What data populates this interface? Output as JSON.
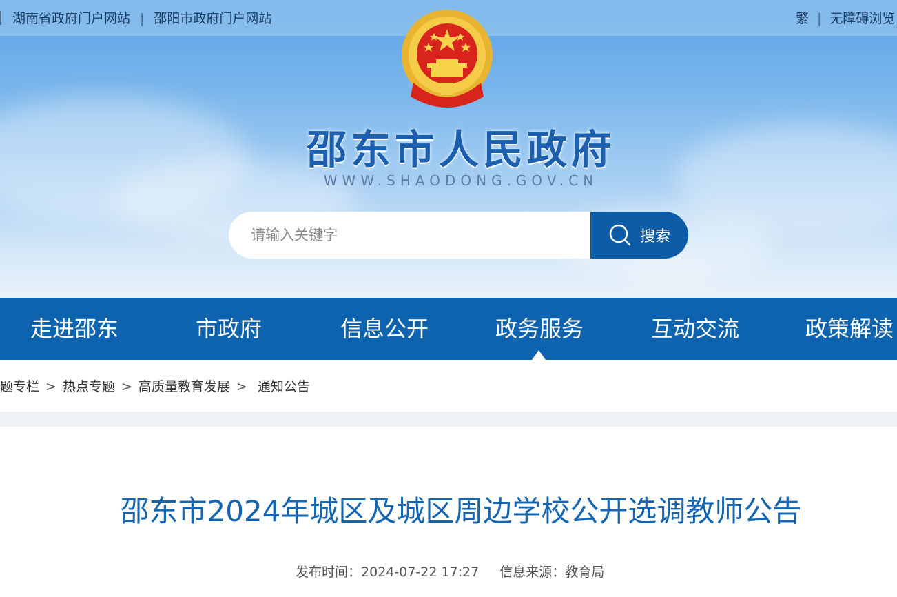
{
  "topbar": {
    "links_left": [
      "湖南省政府门户网站",
      "邵阳市政府门户网站"
    ],
    "traditional_label": "繁",
    "accessibility_label": "无障碍浏览"
  },
  "header": {
    "emblem_icon": "national-emblem-icon",
    "site_title": "邵东市人民政府",
    "site_url": "WWW.SHAODONG.GOV.CN"
  },
  "search": {
    "placeholder": "请输入关键字",
    "button_label": "搜索",
    "icon": "search-icon"
  },
  "nav": {
    "items": [
      "走进邵东",
      "市政府",
      "信息公开",
      "政务服务",
      "互动交流",
      "政策解读"
    ],
    "active": "政务服务"
  },
  "breadcrumb": {
    "items": [
      "题专栏",
      "热点专题",
      "高质量教育发展",
      "通知公告"
    ],
    "separator": ">"
  },
  "article": {
    "title": "邵东市2024年城区及城区周边学校公开选调教师公告",
    "published_label": "发布时间：",
    "published_value": "2024-07-22 17:27",
    "source_label": "信息来源：",
    "source_value": "教育局"
  },
  "colors": {
    "nav_bg": "#0d63ae",
    "title_blue": "#1565b0",
    "search_btn": "#0d5ca8"
  }
}
